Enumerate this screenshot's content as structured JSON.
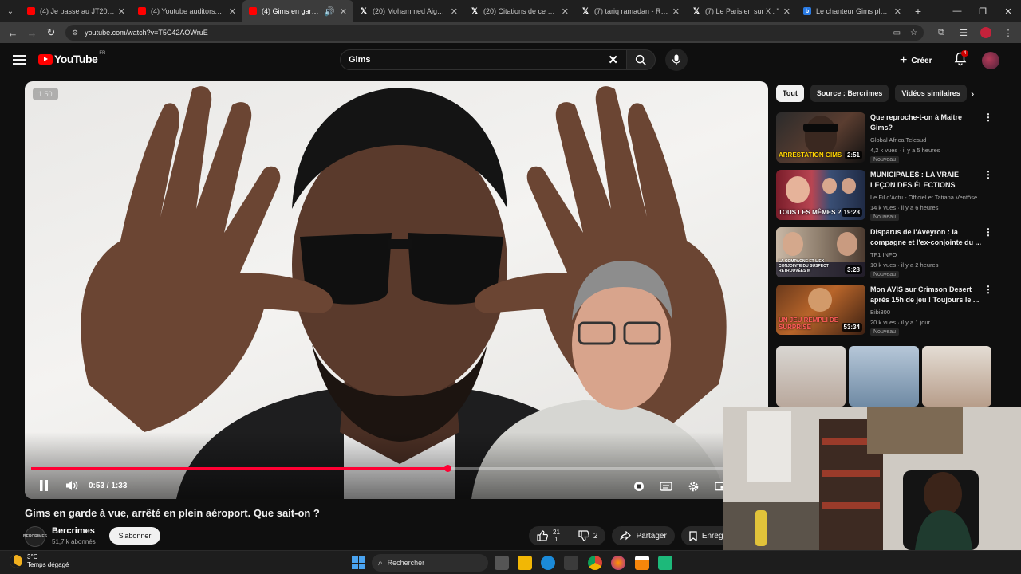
{
  "browser": {
    "tabs": [
      {
        "title": "(4) Je passe au JT20H de",
        "favicon": "youtube-icon",
        "active": false
      },
      {
        "title": "(4) Youtube auditors: ces",
        "favicon": "youtube-icon",
        "active": false
      },
      {
        "title": "(4) Gims en garde à vue",
        "favicon": "youtube-icon",
        "active": true
      },
      {
        "title": "(20) Mohammed Aigoin (",
        "favicon": "x-icon",
        "active": false
      },
      {
        "title": "(20) Citations de ce post",
        "favicon": "x-icon",
        "active": false
      },
      {
        "title": "(7) tariq ramadan - Reche",
        "favicon": "x-icon",
        "active": false
      },
      {
        "title": "(7) Le Parisien sur X : \"",
        "favicon": "x-icon",
        "active": false
      },
      {
        "title": "Le chanteur Gims placé e",
        "favicon": "bing-icon",
        "active": false
      }
    ],
    "url": "youtube.com/watch?v=T5C42AOWruE"
  },
  "youtube": {
    "logo_text": "YouTube",
    "logo_country": "FR",
    "search_value": "Gims",
    "create_label": "Créer",
    "notification_count": "4",
    "player": {
      "speed_badge": "1.50",
      "time_current": "0:53",
      "time_sep": " / ",
      "time_total": "1:33",
      "progress_fraction": 0.57
    },
    "video": {
      "title": "Gims en garde à vue, arrêté en plein aéroport. Que sait-on ?",
      "channel_name": "Bercrimes",
      "channel_subs": "51,7 k abonnés",
      "channel_avatar_text": "BERCRIMES",
      "subscribe_label": "S'abonner",
      "likes_top": "21",
      "likes_bottom": "1",
      "dislikes": "2",
      "share_label": "Partager",
      "save_label": "Enregist"
    },
    "chips": [
      "Tout",
      "Source : Bercrimes",
      "Vidéos similaires"
    ],
    "recommendations": [
      {
        "title": "Que reproche-t-on à Maitre Gims?",
        "channel": "Global Africa Telesud",
        "meta": "4,2 k vues · il y a 5 heures",
        "badge": "Nouveau",
        "duration": "2:51",
        "thumb_text": "ARRESTATION GIMS"
      },
      {
        "title": "MUNICIPALES : LA VRAIE LEÇON DES ÉLECTIONS",
        "channel": "Le Fil d'Actu - Officiel et Tatiana Ventôse",
        "meta": "14 k vues · il y a 6 heures",
        "badge": "Nouveau",
        "duration": "19:23",
        "thumb_text": "TOUS LES MÊMES ?"
      },
      {
        "title": "Disparus de l'Aveyron : la compagne et l'ex-conjointe du ...",
        "channel": "TF1 INFO",
        "meta": "10 k vues · il y a 2 heures",
        "badge": "Nouveau",
        "duration": "3:28",
        "thumb_text": "LA COMPAGNE ET L'EX-CONJOINTE DU SUSPECT RETROUVÉES M"
      },
      {
        "title": "Mon AVIS sur Crimson Desert après 15h de jeu ! Toujours le ...",
        "channel": "Bibi300",
        "meta": "20 k vues · il y a 1 jour",
        "badge": "Nouveau",
        "duration": "53:34",
        "thumb_text": "UN JEU REMPLI DE SURPRISE"
      }
    ]
  },
  "taskbar": {
    "temperature": "3°C",
    "weather": "Temps dégagé",
    "search_label": "Rechercher"
  },
  "colors": {
    "accent_red": "#ff0033",
    "background": "#0f0f0f"
  }
}
